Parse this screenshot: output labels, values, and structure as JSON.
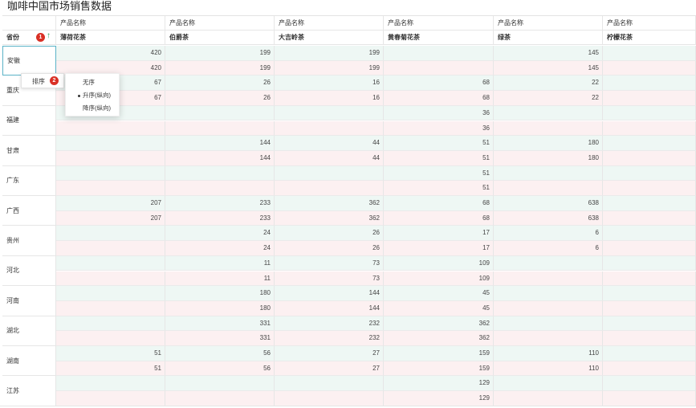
{
  "title": "咖啡中国市场销售数据",
  "header": {
    "group_label": "产品名称",
    "row_label": "省份",
    "products": [
      "薄荷花茶",
      "伯爵茶",
      "大吉岭茶",
      "黄春菊花茶",
      "绿茶",
      "柠檬花茶"
    ]
  },
  "sort_button_label": "排序",
  "sort_menu": {
    "none": "无序",
    "asc": "升序(纵向)",
    "desc": "降序(纵向)"
  },
  "badges": {
    "first": "1",
    "second": "2"
  },
  "rows": [
    {
      "province": "安徽",
      "values": [
        "420",
        "199",
        "199",
        "",
        "145",
        ""
      ]
    },
    {
      "province": "重庆",
      "values": [
        "67",
        "26",
        "16",
        "68",
        "22",
        ""
      ]
    },
    {
      "province": "福建",
      "values": [
        "",
        "",
        "",
        "36",
        "",
        ""
      ]
    },
    {
      "province": "甘肃",
      "values": [
        "",
        "144",
        "44",
        "51",
        "180",
        ""
      ]
    },
    {
      "province": "广东",
      "values": [
        "",
        "",
        "",
        "51",
        "",
        ""
      ]
    },
    {
      "province": "广西",
      "values": [
        "207",
        "233",
        "362",
        "68",
        "638",
        ""
      ]
    },
    {
      "province": "贵州",
      "values": [
        "",
        "24",
        "26",
        "17",
        "6",
        ""
      ]
    },
    {
      "province": "河北",
      "values": [
        "",
        "11",
        "73",
        "109",
        "",
        ""
      ]
    },
    {
      "province": "河南",
      "values": [
        "",
        "180",
        "144",
        "45",
        "",
        ""
      ]
    },
    {
      "province": "湖北",
      "values": [
        "",
        "331",
        "232",
        "362",
        "",
        ""
      ]
    },
    {
      "province": "湖南",
      "values": [
        "51",
        "56",
        "27",
        "159",
        "110",
        ""
      ]
    },
    {
      "province": "江苏",
      "values": [
        "",
        "",
        "",
        "129",
        "",
        ""
      ]
    }
  ]
}
